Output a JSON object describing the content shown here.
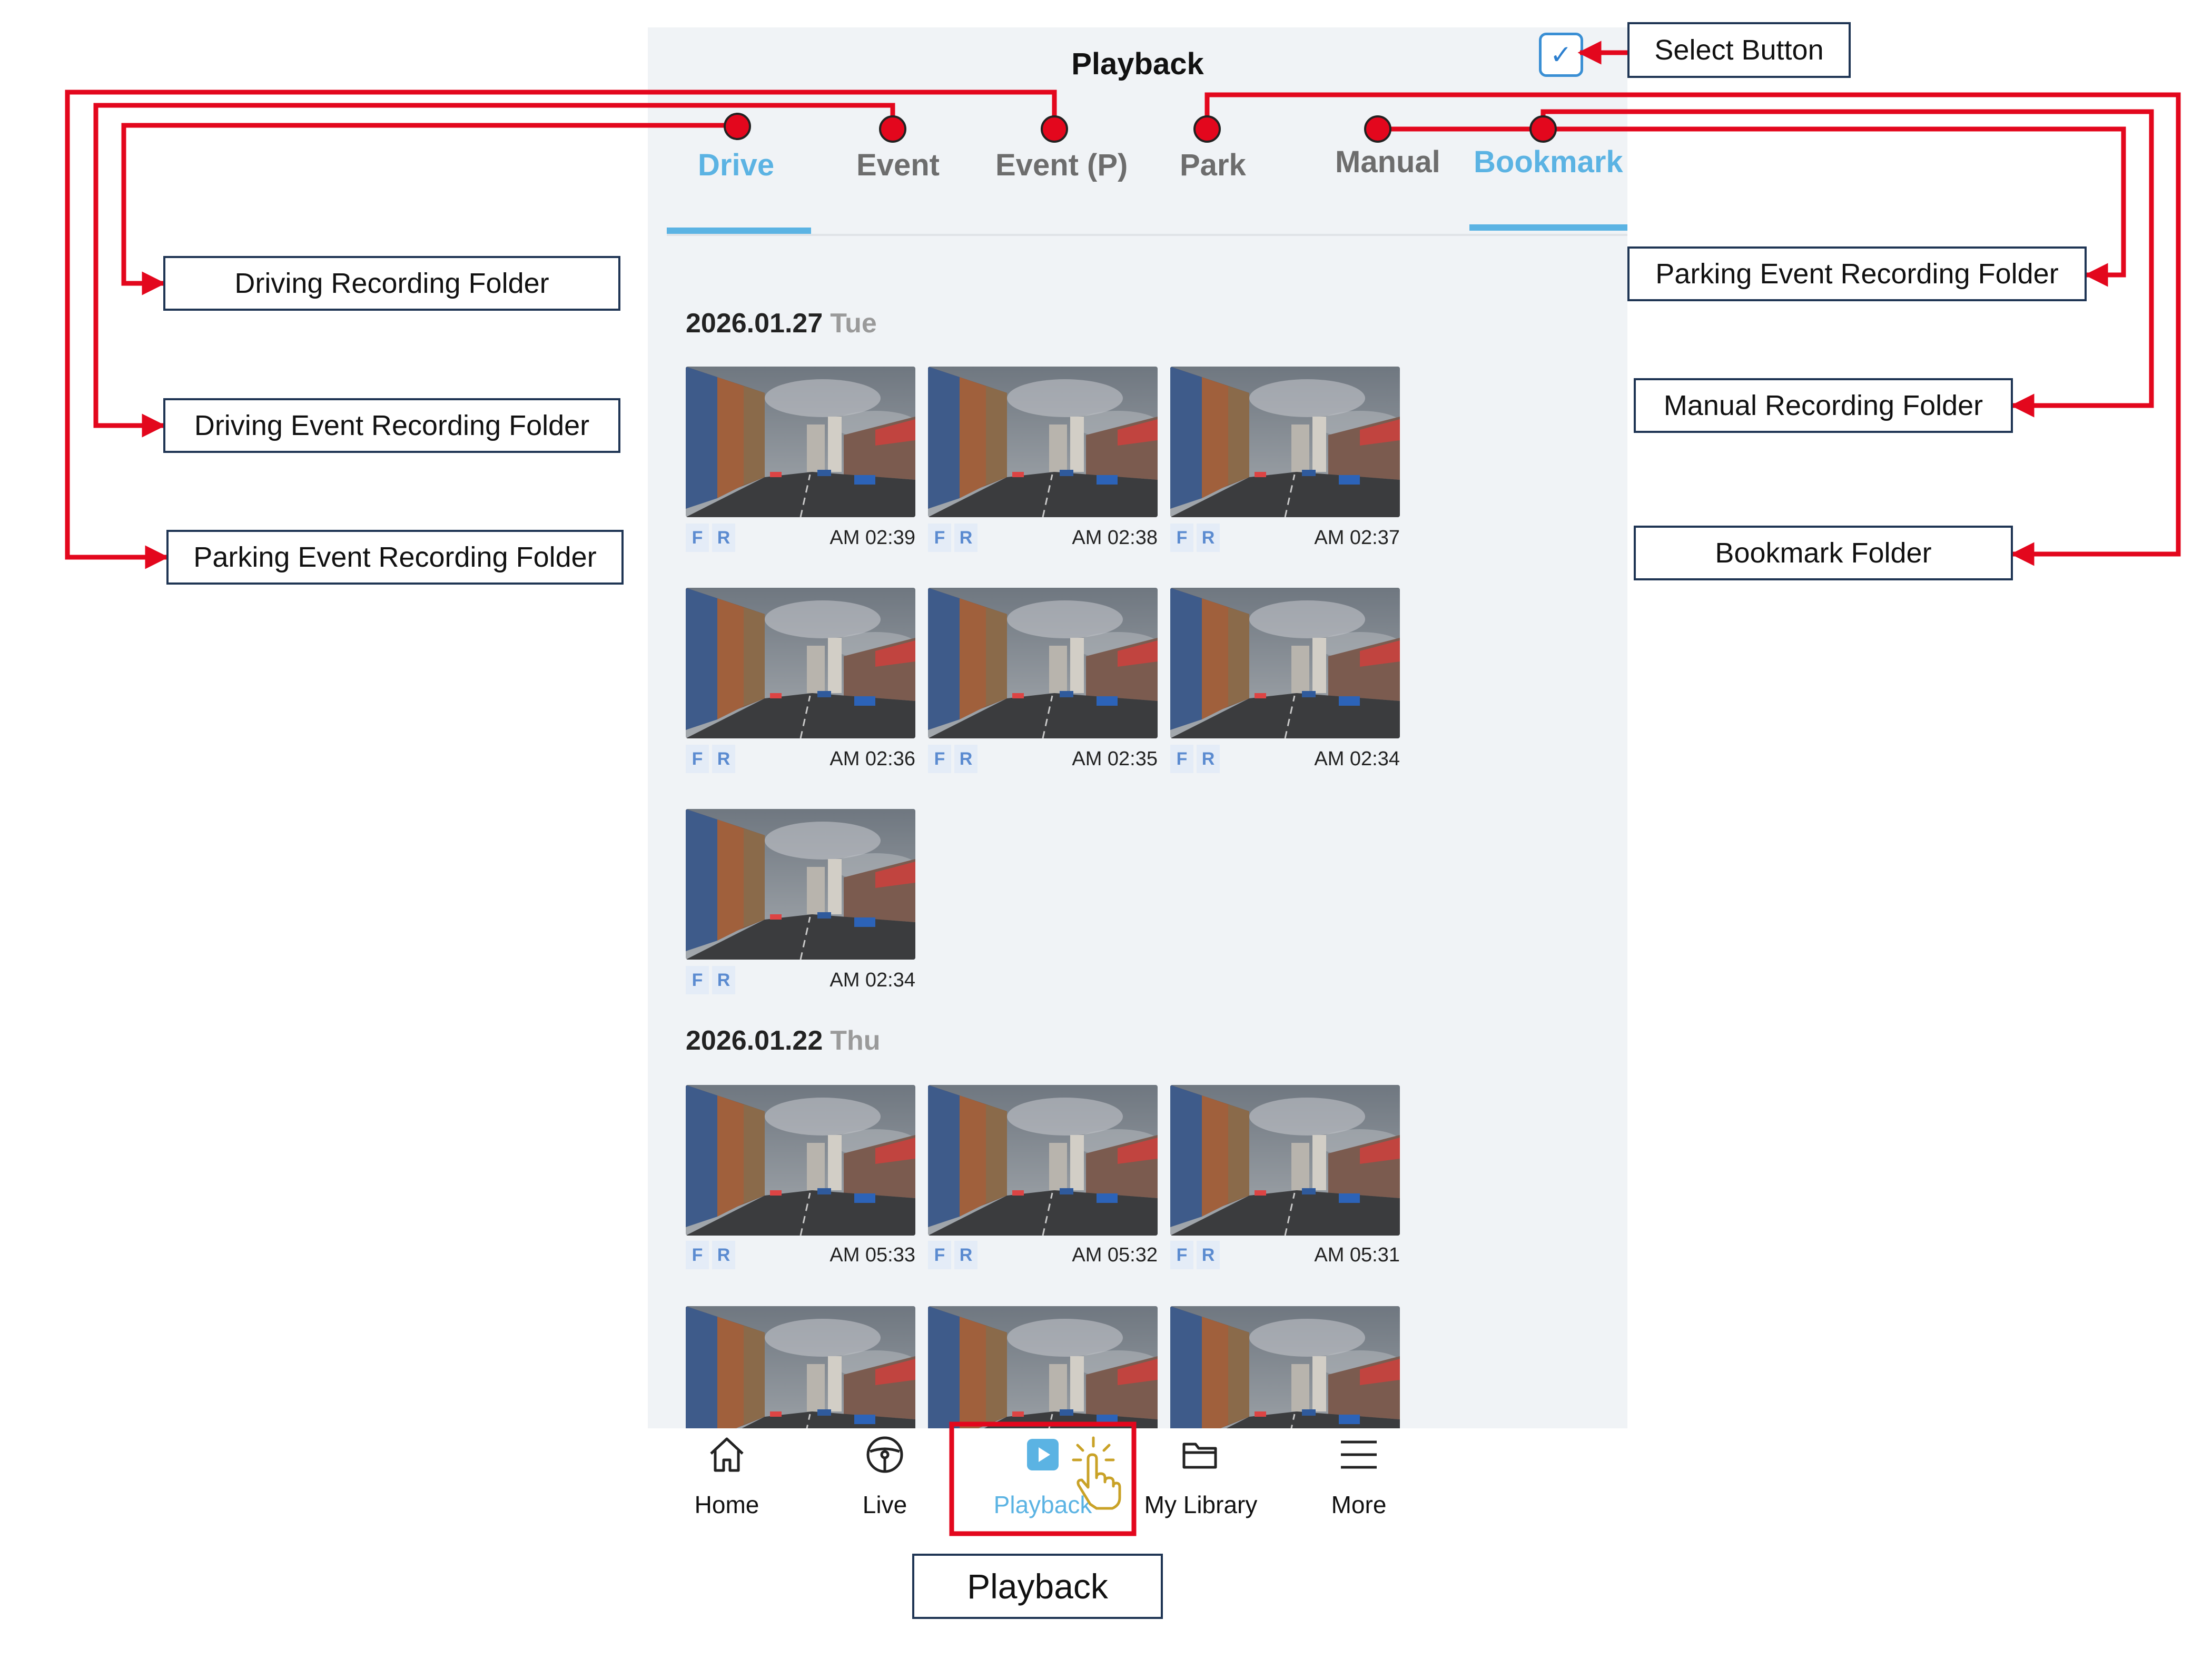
{
  "header": {
    "title": "Playback",
    "select_icon": "check-icon"
  },
  "tabs": [
    {
      "label": "Drive",
      "active": true
    },
    {
      "label": "Event",
      "active": false
    },
    {
      "label": "Event (P)",
      "active": false
    },
    {
      "label": "Park",
      "active": false
    },
    {
      "label": "Manual",
      "active": false
    },
    {
      "label": "Bookmark",
      "active": false
    }
  ],
  "sections": [
    {
      "date": "2026.01.27",
      "weekday": "Tue",
      "clips": [
        {
          "front": "F",
          "rear": "R",
          "time": "AM 02:39"
        },
        {
          "front": "F",
          "rear": "R",
          "time": "AM 02:38"
        },
        {
          "front": "F",
          "rear": "R",
          "time": "AM 02:37"
        },
        {
          "front": "F",
          "rear": "R",
          "time": "AM 02:36"
        },
        {
          "front": "F",
          "rear": "R",
          "time": "AM 02:35"
        },
        {
          "front": "F",
          "rear": "R",
          "time": "AM 02:34"
        },
        {
          "front": "F",
          "rear": "R",
          "time": "AM 02:34"
        }
      ]
    },
    {
      "date": "2026.01.22",
      "weekday": "Thu",
      "clips": [
        {
          "front": "F",
          "rear": "R",
          "time": "AM 05:33"
        },
        {
          "front": "F",
          "rear": "R",
          "time": "AM 05:32"
        },
        {
          "front": "F",
          "rear": "R",
          "time": "AM 05:31"
        }
      ]
    }
  ],
  "nav": [
    {
      "label": "Home",
      "icon": "home-icon"
    },
    {
      "label": "Live",
      "icon": "steering-wheel-icon"
    },
    {
      "label": "Playback",
      "icon": "play-icon"
    },
    {
      "label": "My Library",
      "icon": "folder-icon"
    },
    {
      "label": "More",
      "icon": "menu-icon"
    }
  ],
  "annotations": {
    "select_button": "Select Button",
    "driving_recording": "Driving Recording Folder",
    "driving_event": "Driving Event Recording Folder",
    "parking_event_left": "Parking Event Recording Folder",
    "parking_event_right": "Parking Event Recording Folder",
    "manual_recording": "Manual Recording Folder",
    "bookmark_folder": "Bookmark Folder",
    "playback": "Playback"
  },
  "colors": {
    "accent": "#5bb3e3",
    "annotation": "#e3071d",
    "badge_bg": "#e4ecf7",
    "badge_text": "#5b8bd0"
  }
}
